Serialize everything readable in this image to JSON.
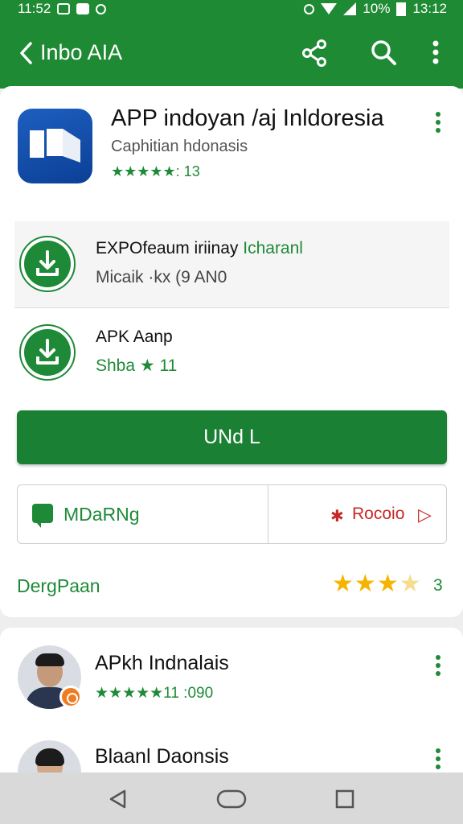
{
  "status_bar": {
    "left_text": "11:52",
    "battery": "10%",
    "time": "13:12"
  },
  "app_bar": {
    "title": "Inbo AIA",
    "icons": [
      "back-icon",
      "share-icon",
      "search-icon",
      "more-icon"
    ]
  },
  "app_header": {
    "title": "APP indoyan /aj Inldoresia",
    "subtitle": "Caphitian hdonasis",
    "rating_text": "★★★★★: 13"
  },
  "download_rows": [
    {
      "title": "EXPOfeaum iriinay",
      "title_highlight": "Icharanl",
      "subtitle": "Micaik ·kx (9 AN0"
    },
    {
      "title": "APK Aanp",
      "subtitle": "Shba ★ 11"
    }
  ],
  "primary_button": {
    "label": "UNd L"
  },
  "split_buttons": {
    "left_label": "MDaRNg",
    "right_label": "Rocoio"
  },
  "rating": {
    "label": "DergPaan",
    "stars": 3.5,
    "count": "3"
  },
  "list": [
    {
      "title": "APkh Indnalais",
      "subtitle": "★★★★★11 :090"
    },
    {
      "title": "Blaanl Daonsis"
    }
  ],
  "colors": {
    "primary": "#1f8a34",
    "accent_red": "#c62828",
    "star": "#f4b400"
  }
}
